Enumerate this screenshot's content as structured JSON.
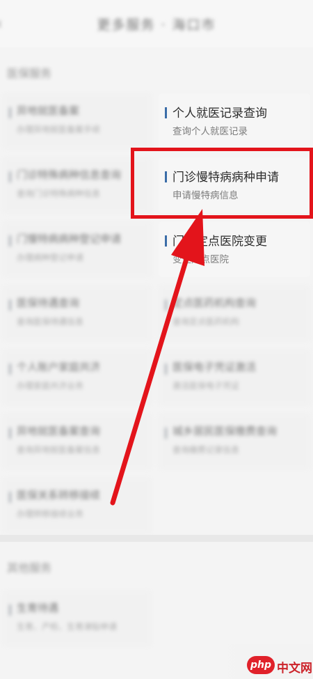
{
  "header": {
    "back_icon": "‹",
    "title": "更多服务 · 海口市"
  },
  "sections": {
    "medical_heading": "医保服务",
    "other_heading": "其他服务"
  },
  "cards": {
    "c1": {
      "title": "异地就医备案",
      "subtitle": "办理异地就医备案手续"
    },
    "c2": {
      "title": "个人就医记录查询",
      "subtitle": "查询个人就医记录"
    },
    "c3": {
      "title": "门诊特殊病种信息查询",
      "subtitle": "查询门诊特殊病种信息"
    },
    "c4": {
      "title": "门诊慢特病病种申请",
      "subtitle": "申请慢特病信息"
    },
    "c5": {
      "title": "门慢特病病种登记申请",
      "subtitle": "办理病种登记申请"
    },
    "c6": {
      "title": "门特定点医院变更",
      "subtitle": "变更定点医院"
    },
    "c7": {
      "title": "医保待遇查询",
      "subtitle": "查询医保待遇信息"
    },
    "c8": {
      "title": "定点医药机构查询",
      "subtitle": "查询定点医药机构"
    },
    "c9": {
      "title": "个人账户家庭共济",
      "subtitle": "办理家庭共济业务"
    },
    "c10": {
      "title": "医保电子凭证激活",
      "subtitle": "激活医保电子凭证"
    },
    "c11": {
      "title": "异地就医备案查询",
      "subtitle": "查询异地就医备案信息"
    },
    "c12": {
      "title": "城乡居民医保缴费查询",
      "subtitle": "查询缴费记录信息"
    },
    "c13": {
      "title": "医保关系转移接续",
      "subtitle": "办理转移接续业务"
    },
    "c14": {
      "title": "生育待遇",
      "subtitle": "生育、产检、生育津贴申请"
    }
  },
  "colors": {
    "highlight": "#e3141b",
    "arrow": "#e3141b",
    "accent_bar": "#3b6da8"
  },
  "watermark": {
    "logo": "php",
    "text": "中文网"
  }
}
